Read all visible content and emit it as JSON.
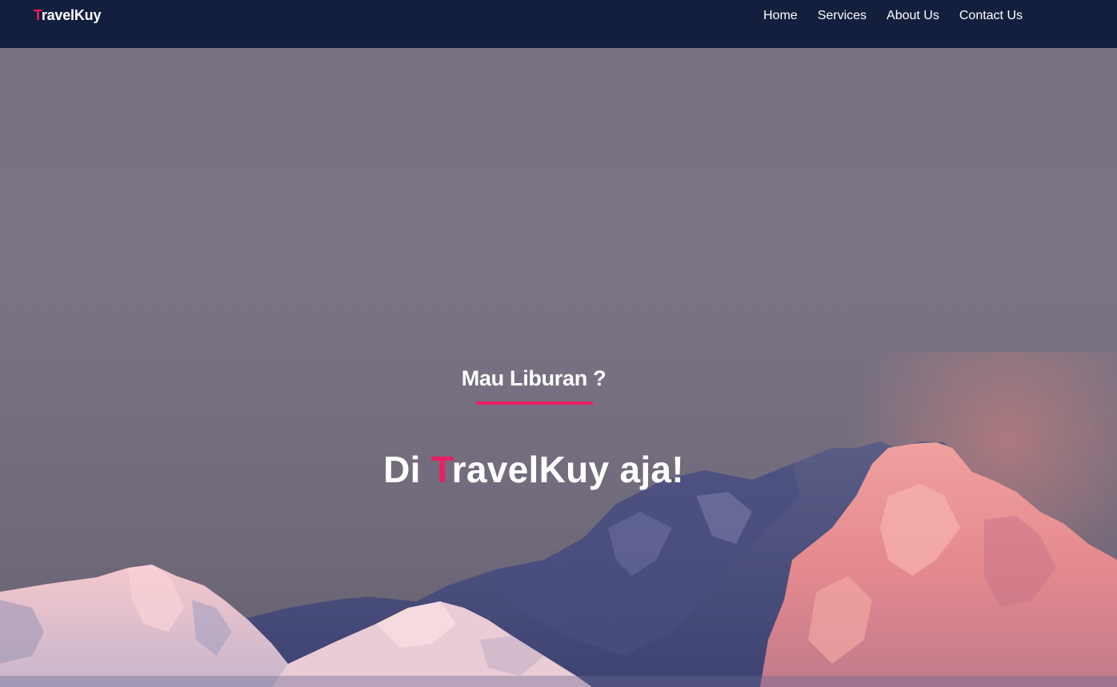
{
  "navbar": {
    "brand_first": "T",
    "brand_rest": "ravelKuy",
    "links": [
      {
        "label": "Home"
      },
      {
        "label": "Services"
      },
      {
        "label": "About Us"
      },
      {
        "label": "Contact Us"
      }
    ]
  },
  "hero": {
    "subtitle": "Mau Liburan ?",
    "title_prefix": "Di ",
    "title_accent": "T",
    "title_suffix": "ravelKuy aja!",
    "background_image": "snowy-mountain-range-at-dusk"
  },
  "colors": {
    "navbar_bg": "#131f3d",
    "accent": "#e91e63",
    "text": "#ffffff"
  }
}
